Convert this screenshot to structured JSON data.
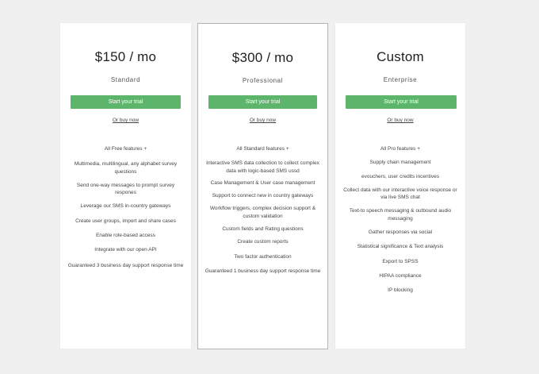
{
  "plans": [
    {
      "price": "$150 / mo",
      "tier": "Standard",
      "cta": "Start your trial",
      "buy": "Or buy now",
      "features": [
        "All Free features +",
        "Multimedia, multilingual, any alphabet survey questions",
        "Send one-way messages to prompt survey respones",
        "Leverage our SMS in-country gateways",
        "Create user groups, import and share cases",
        "Enable role-based access",
        "Integrate with our open API",
        "Guaranteed 3 business day support response time"
      ]
    },
    {
      "price": "$300 / mo",
      "tier": "Professional",
      "cta": "Start your trial",
      "buy": "Or buy now",
      "features": [
        "All Standard features +",
        "Interactive SMS data collection to collect complex data with logic-based SMS ussd",
        "Case Management & User case management",
        "Support to connect new in country gateways",
        "Workflow triggers, complex decision support & custom validation",
        "Custom fields and Rating questions",
        "Create custom reports",
        "Two factor authentication",
        "Guaranteed 1 business day support response time"
      ]
    },
    {
      "price": "Custom",
      "tier": "Enterprise",
      "cta": "Start your trial",
      "buy": "Or buy now",
      "features": [
        "All Pro features +",
        "Supply chain management",
        "evouchers, user credits incentives",
        "Collect data with our interactive voice response or via live SMS chat",
        "Text-to speech messaging & outbound audio messaging",
        "Gather responses via social",
        "Statistical significance & Text analysis",
        "Export to SPSS",
        "HIPAA compliance",
        "IP blocking"
      ]
    }
  ],
  "colors": {
    "cta": "#5cb56b",
    "background": "#f0f0f0",
    "card": "#ffffff"
  }
}
